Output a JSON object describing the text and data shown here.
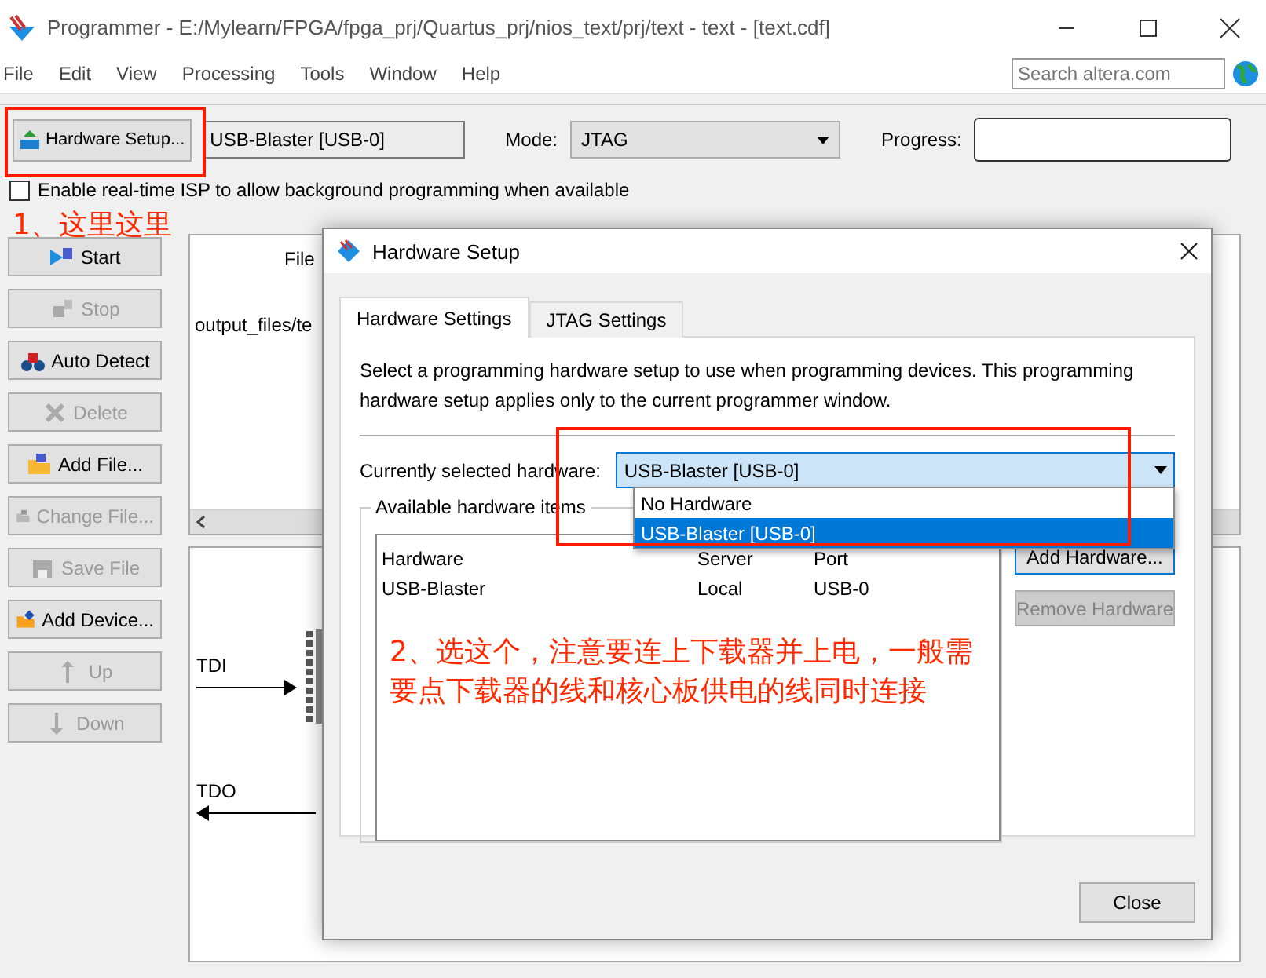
{
  "window": {
    "title": "Programmer - E:/Mylearn/FPGA/fpga_prj/Quartus_prj/nios_text/prj/text - text - [text.cdf]"
  },
  "menu": [
    "File",
    "Edit",
    "View",
    "Processing",
    "Tools",
    "Window",
    "Help"
  ],
  "search": {
    "placeholder": "Search altera.com"
  },
  "toolbar": {
    "hardware_setup": "Hardware Setup...",
    "hardware": "USB-Blaster [USB-0]",
    "mode_label": "Mode:",
    "mode": "JTAG",
    "progress_label": "Progress:",
    "progress": {
      "level": 0
    }
  },
  "isp_checkbox": {
    "label": "Enable real-time ISP to allow background programming when available",
    "checked": false
  },
  "side_buttons": [
    {
      "label": "Start",
      "disabled": false
    },
    {
      "label": "Stop",
      "disabled": true
    },
    {
      "label": "Auto Detect",
      "disabled": false
    },
    {
      "label": "Delete",
      "disabled": true
    },
    {
      "label": "Add File...",
      "disabled": false
    },
    {
      "label": "Change File...",
      "disabled": true
    },
    {
      "label": "Save File",
      "disabled": true
    },
    {
      "label": "Add Device...",
      "disabled": false
    },
    {
      "label": "Up",
      "disabled": true
    },
    {
      "label": "Down",
      "disabled": true
    }
  ],
  "file_table": {
    "column": "File",
    "row": "output_files/te"
  },
  "chain": {
    "tdi": "TDI",
    "tdo": "TDO"
  },
  "annotations": [
    "1、这里这里",
    "2、选这个，注意要连上下载器并上电，一般需要点下载器的线和核心板供电的线同时连接"
  ],
  "dialog": {
    "title": "Hardware Setup",
    "tabs": [
      {
        "label": "Hardware Settings",
        "selected": true
      },
      {
        "label": "JTAG Settings",
        "selected": false
      }
    ],
    "description": "Select a programming hardware setup to use when programming devices. This programming hardware setup applies only to the current programmer window.",
    "hardware_label": "Currently selected hardware:",
    "hardware_value": "USB-Blaster [USB-0]",
    "dropdown_open": true,
    "options": [
      {
        "label": "No Hardware",
        "selected": false
      },
      {
        "label": "USB-Blaster [USB-0]",
        "selected": true
      }
    ],
    "group_title": "Available hardware items",
    "columns": [
      "Hardware",
      "Server",
      "Port"
    ],
    "rows": [
      [
        "USB-Blaster",
        "Local",
        "USB-0"
      ]
    ],
    "buttons": [
      {
        "label": "Add Hardware...",
        "disabled": false
      },
      {
        "label": "Remove Hardware",
        "disabled": true
      }
    ],
    "close": "Close"
  }
}
